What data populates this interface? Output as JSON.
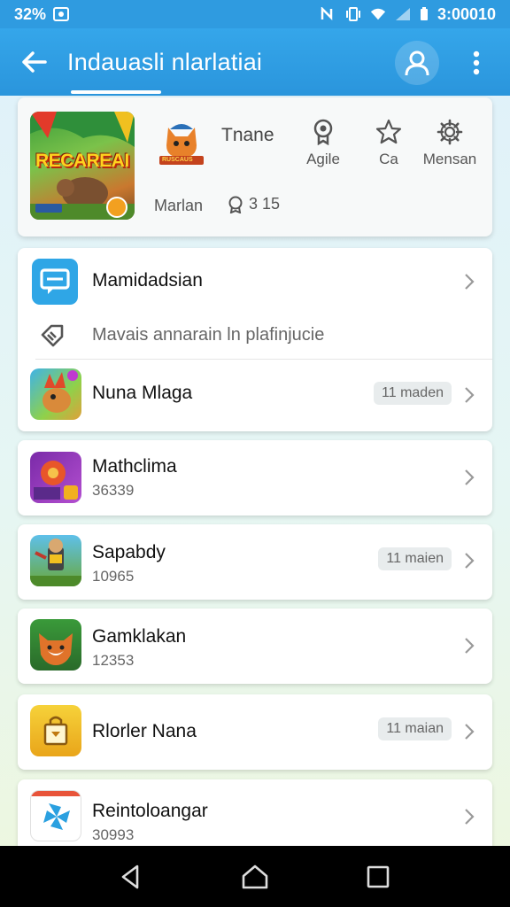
{
  "status": {
    "left_text": "32%",
    "time": "3:00010"
  },
  "appbar": {
    "title": "Indauasli nlarlatiai"
  },
  "header": {
    "feature_art_text": "RECAREAI",
    "small_logo_text": "RUSCAUS",
    "name": "Tnane",
    "actions": [
      {
        "label": "Agile",
        "icon": "badge-icon"
      },
      {
        "label": "Ca",
        "icon": "star-icon"
      },
      {
        "label": "Mensan",
        "icon": "gear-icon"
      }
    ],
    "meta": "Marlan",
    "count": "3 15"
  },
  "list": {
    "group1": {
      "row1_title": "Mamidadsian",
      "row2_text": "Mavais annarain ln plafinjucie",
      "row3_title": "Nuna Mlaga",
      "row3_pill": "11 maden"
    },
    "items": [
      {
        "title": "Mathclima",
        "sub": "36339",
        "pill": ""
      },
      {
        "title": "Sapabdy",
        "sub": "10965",
        "pill": "11 maien"
      },
      {
        "title": "Gamklakan",
        "sub": "12353",
        "pill": ""
      },
      {
        "title": "Rlorler Nana",
        "sub": "",
        "pill": "11 maian"
      },
      {
        "title": "Reintoloangar",
        "sub": "30993",
        "pill": ""
      }
    ]
  },
  "colors": {
    "primary": "#2f9be0",
    "accent_chat": "#2fa6e6",
    "nav_bg": "#000000"
  }
}
